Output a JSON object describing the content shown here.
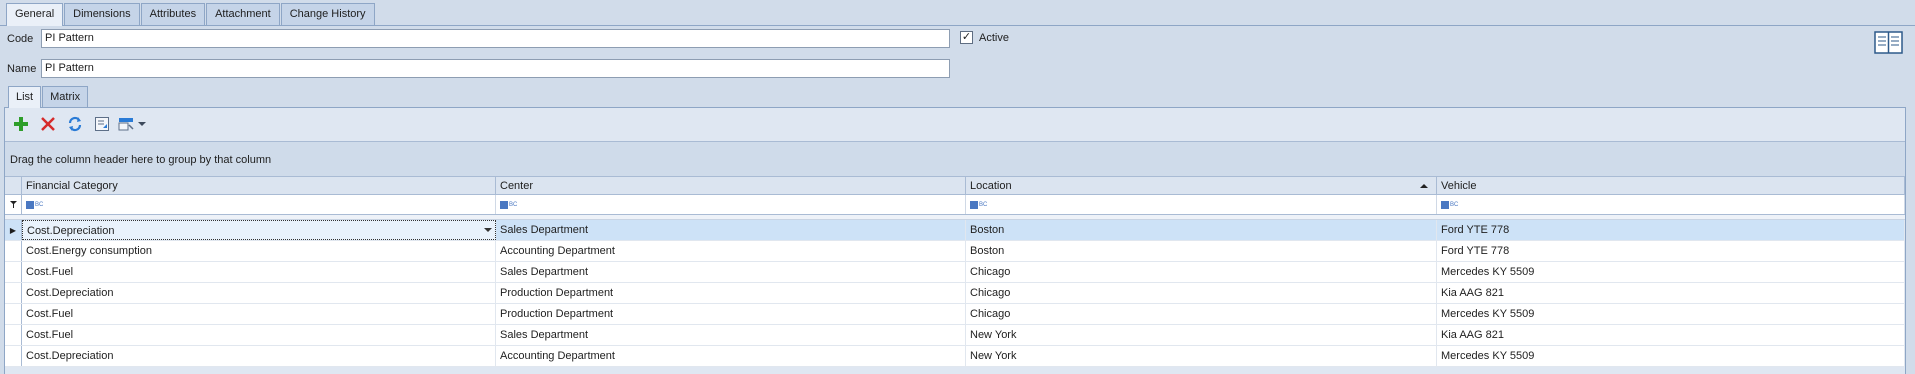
{
  "tabs": [
    "General",
    "Dimensions",
    "Attributes",
    "Attachment",
    "Change History"
  ],
  "form": {
    "code_label": "Code",
    "code_value": "PI Pattern",
    "name_label": "Name",
    "name_value": "PI Pattern",
    "active_label": "Active",
    "active_checked": true
  },
  "inner_tabs": [
    "List",
    "Matrix"
  ],
  "toolbar": {
    "icons": [
      "add-icon",
      "delete-icon",
      "refresh-icon",
      "export-icon",
      "layout-icon",
      "dropdown-arrow-icon"
    ]
  },
  "grid": {
    "group_hint": "Drag the column header here to group by that column",
    "columns": [
      "Financial Category",
      "Center",
      "Location",
      "Vehicle"
    ],
    "sorted_column": "Location",
    "rows": [
      [
        "Cost.Depreciation",
        "Sales Department",
        "Boston",
        "Ford YTE 778"
      ],
      [
        "Cost.Energy consumption",
        "Accounting Department",
        "Boston",
        "Ford YTE 778"
      ],
      [
        "Cost.Fuel",
        "Sales Department",
        "Chicago",
        "Mercedes KY 5509"
      ],
      [
        "Cost.Depreciation",
        "Production Department",
        "Chicago",
        "Kia AAG 821"
      ],
      [
        "Cost.Fuel",
        "Production Department",
        "Chicago",
        "Mercedes KY 5509"
      ],
      [
        "Cost.Fuel",
        "Sales Department",
        "New York",
        "Kia AAG 821"
      ],
      [
        "Cost.Depreciation",
        "Accounting Department",
        "New York",
        "Mercedes KY 5509"
      ]
    ]
  },
  "colors": {
    "background": "#d1dcea",
    "selected_row": "#cde2f7",
    "add": "#2e9e2a",
    "delete": "#d62b2b",
    "refresh": "#2a7bd6"
  }
}
